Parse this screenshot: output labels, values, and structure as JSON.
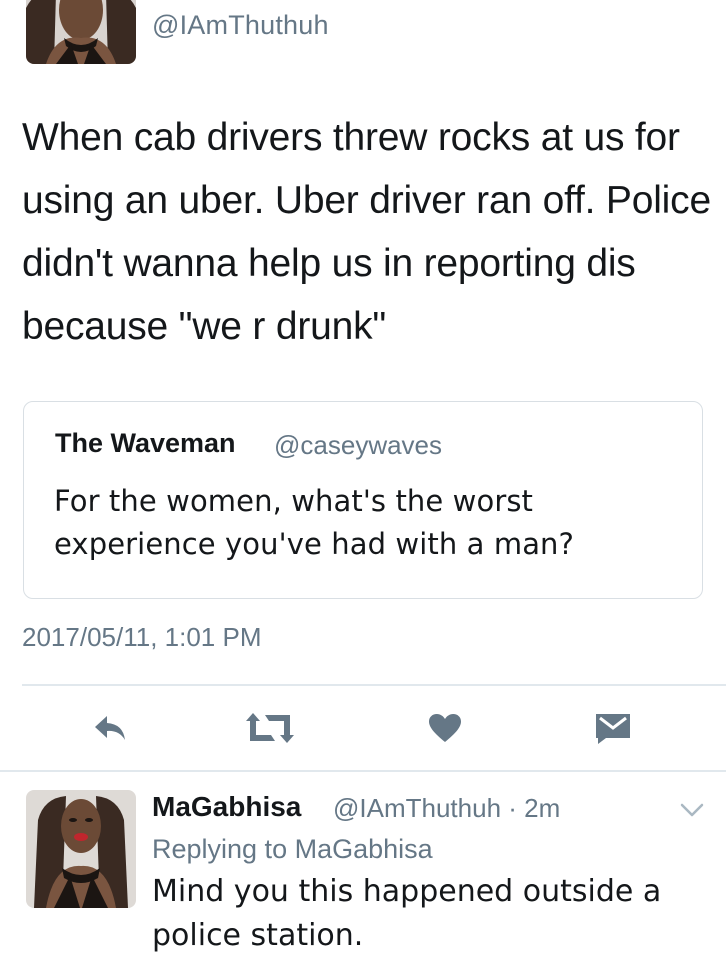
{
  "main_tweet": {
    "handle": "@IAmThuthuh",
    "text": "When cab drivers threw rocks at us for using an uber. Uber driver ran off. Police didn't wanna help us in reporting dis because \"we r drunk\"",
    "timestamp": "2017/05/11, 1:01 PM",
    "quoted": {
      "name": "The Waveman",
      "handle": "@caseywaves",
      "text": "For the women, what's the worst experience you've had with a man?"
    }
  },
  "actions": [
    {
      "icon": "reply-icon"
    },
    {
      "icon": "retweet-icon"
    },
    {
      "icon": "heart-icon"
    },
    {
      "icon": "direct-message-icon"
    }
  ],
  "reply_tweet": {
    "name": "MaGabhisa",
    "meta": "@IAmThuthuh · 2m",
    "replying_to": "Replying to MaGabhisa",
    "text": "Mind you this happened outside a police station."
  },
  "colors": {
    "text": "#14171a",
    "muted": "#657786",
    "icon": "#657786",
    "border": "#e1e8ed",
    "chevron": "#aab8c2"
  }
}
